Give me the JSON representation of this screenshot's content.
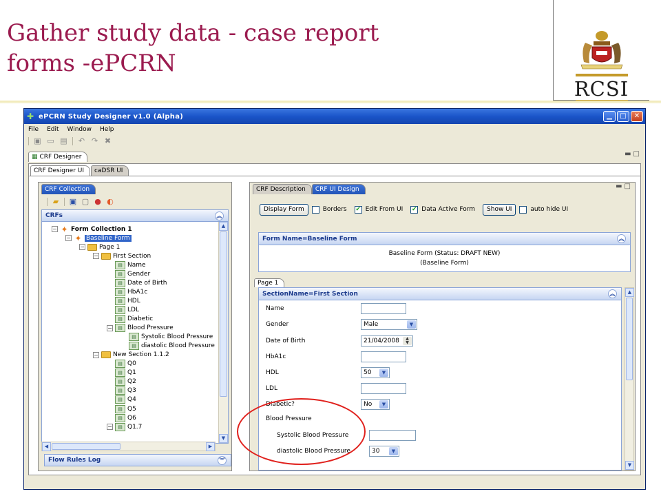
{
  "slide": {
    "title_line1": "Gather study data - case report",
    "title_line2": "forms -ePCRN",
    "logo_text": "RCSI"
  },
  "window": {
    "title": "ePCRN Study Designer v1.0 (Alpha)",
    "menu": [
      "File",
      "Edit",
      "Window",
      "Help"
    ],
    "view_tab": "CRF Designer",
    "designer_tabs": [
      "CRF Designer UI",
      "caDSR UI"
    ]
  },
  "left_panel": {
    "tab": "CRF Collection",
    "section_title": "CRFs",
    "tree": [
      {
        "label": "Form Collection 1",
        "level": 0,
        "kind": "form",
        "expander": "minus",
        "bold": true
      },
      {
        "label": "Baseline Form",
        "level": 1,
        "kind": "form",
        "expander": "minus",
        "selected": true
      },
      {
        "label": "Page 1",
        "level": 2,
        "kind": "folder",
        "expander": "minus"
      },
      {
        "label": "First Section",
        "level": 3,
        "kind": "folder",
        "expander": "minus"
      },
      {
        "label": "Name",
        "level": 4,
        "kind": "leaf"
      },
      {
        "label": "Gender",
        "level": 4,
        "kind": "leaf"
      },
      {
        "label": "Date of Birth",
        "level": 4,
        "kind": "leaf"
      },
      {
        "label": "HbA1c",
        "level": 4,
        "kind": "leaf"
      },
      {
        "label": "HDL",
        "level": 4,
        "kind": "leaf"
      },
      {
        "label": "LDL",
        "level": 4,
        "kind": "leaf"
      },
      {
        "label": "Diabetic",
        "level": 4,
        "kind": "leaf"
      },
      {
        "label": "Blood Pressure",
        "level": 4,
        "kind": "leaf",
        "expander": "minus"
      },
      {
        "label": "Systolic Blood Pressure",
        "level": 5,
        "kind": "leaf"
      },
      {
        "label": "diastolic Blood Pressure",
        "level": 5,
        "kind": "leaf"
      },
      {
        "label": "New Section 1.1.2",
        "level": 3,
        "kind": "folder",
        "expander": "minus"
      },
      {
        "label": "Q0",
        "level": 4,
        "kind": "leaf"
      },
      {
        "label": "Q1",
        "level": 4,
        "kind": "leaf"
      },
      {
        "label": "Q2",
        "level": 4,
        "kind": "leaf"
      },
      {
        "label": "Q3",
        "level": 4,
        "kind": "leaf"
      },
      {
        "label": "Q4",
        "level": 4,
        "kind": "leaf"
      },
      {
        "label": "Q5",
        "level": 4,
        "kind": "leaf"
      },
      {
        "label": "Q6",
        "level": 4,
        "kind": "leaf"
      },
      {
        "label": "Q1.7",
        "level": 4,
        "kind": "leaf",
        "expander": "minus"
      }
    ],
    "flow_rules_title": "Flow Rules Log"
  },
  "right_panel": {
    "tabs": [
      "CRF Description",
      "CRF UI Design"
    ],
    "display_form_label": "Display Form",
    "borders_label": "Borders",
    "edit_from_ui_label": "Edit From UI",
    "data_active_form_label": "Data Active Form",
    "show_ui_label": "Show UI",
    "auto_hide_label": "auto hide UI",
    "borders_checked": false,
    "edit_from_ui_checked": true,
    "data_active_form_checked": true,
    "auto_hide_checked": false,
    "form_name_title": "Form Name=Baseline Form",
    "form_status_line1": "Baseline Form (Status: DRAFT NEW)",
    "form_status_line2": "(Baseline Form)",
    "page_tab": "Page 1",
    "section_title": "SectionName=First Section",
    "fields": {
      "name": {
        "label": "Name",
        "value": ""
      },
      "gender": {
        "label": "Gender",
        "value": "Male"
      },
      "dob": {
        "label": "Date of Birth",
        "value": "21/04/2008"
      },
      "hba1c": {
        "label": "HbA1c",
        "value": ""
      },
      "hdl": {
        "label": "HDL",
        "value": "50"
      },
      "ldl": {
        "label": "LDL",
        "value": ""
      },
      "diabetic": {
        "label": "Diabetic?",
        "value": "No"
      },
      "bp": {
        "label": "Blood Pressure"
      },
      "systolic": {
        "label": "Systolic Blood Pressure",
        "value": ""
      },
      "diastolic": {
        "label": "diastolic Blood Pressure",
        "value": "30"
      }
    }
  },
  "colors": {
    "title": "#9b1b4f",
    "highlight_ellipse": "#e0201c",
    "titlebar": "#1a54c8"
  }
}
